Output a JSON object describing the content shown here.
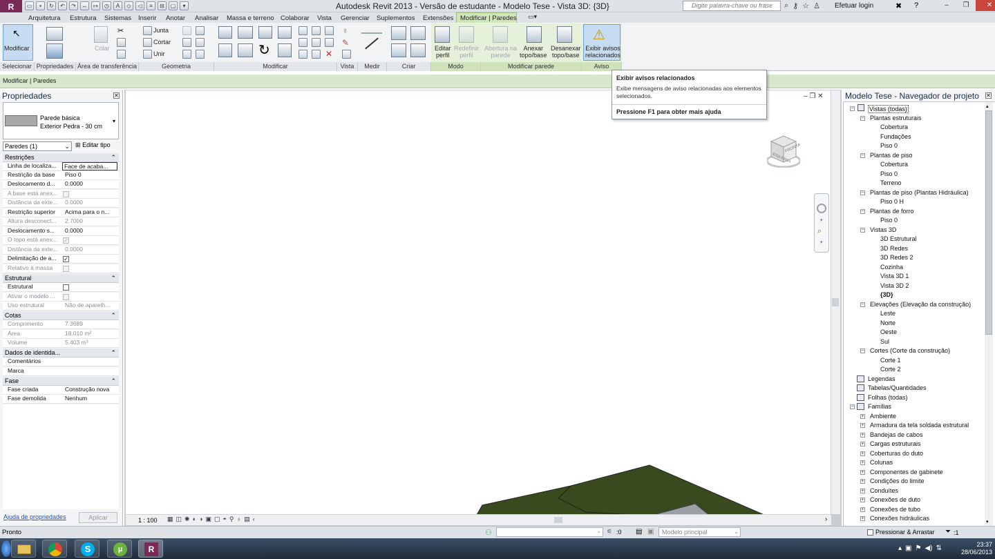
{
  "app": {
    "logo": "R",
    "title": "Autodesk Revit 2013 - Versão de estudante -     Modelo Tese - Vista 3D: {3D}",
    "search_placeholder": "Digite palavra-chave ou frase",
    "login": "Efetuar login"
  },
  "tabs": [
    "Arquitetura",
    "Estrutura",
    "Sistemas",
    "Inserir",
    "Anotar",
    "Analisar",
    "Massa e terreno",
    "Colaborar",
    "Vista",
    "Gerenciar",
    "Suplementos",
    "Extensões",
    "Modificar | Paredes"
  ],
  "ribbon": {
    "modificar": "Modificar",
    "colar": "Colar",
    "junta": "Junta",
    "cortar": "Cortar",
    "unir": "Unir",
    "editar_perfil": [
      "Editar",
      "perfil"
    ],
    "redefinir_perfil": [
      "Redefinir",
      "perfil"
    ],
    "abertura_parede": [
      "Abertura na",
      "parede"
    ],
    "anexar": [
      "Anexar",
      "topo/base"
    ],
    "desanexar": [
      "Desanexar",
      "topo/base"
    ],
    "exibir_avisos": [
      "Exibir avisos",
      "relacionados"
    ],
    "panels": [
      "Selecionar",
      "Propriedades",
      "Área de transferência",
      "Geometria",
      "Modificar",
      "Vista",
      "Medir",
      "Criar",
      "Modo",
      "Modificar parede",
      "Aviso"
    ]
  },
  "options_bar": "Modificar | Paredes",
  "tooltip": {
    "title": "Exibir avisos relacionados",
    "body": "Exibe mensagens de aviso relacionadas aos elementos selecionados.",
    "help": "Pressione F1 para obter mais ajuda"
  },
  "properties": {
    "title": "Propriedades",
    "type_name": "Parede básica",
    "type_sub": "Exterior Pedra - 30 cm",
    "instance": "Paredes (1)",
    "edit_type": "Editar tipo",
    "categories": {
      "restricoes": "Restrições",
      "estrutural": "Estrutural",
      "cotas": "Cotas",
      "dados": "Dados de identida...",
      "fase": "Fase"
    },
    "rows": [
      {
        "name": "Linha de localiza...",
        "value": "Face de acaba..."
      },
      {
        "name": "Restrição da base",
        "value": "Piso 0"
      },
      {
        "name": "Deslocamento d...",
        "value": "0.0000"
      },
      {
        "name": "A base está anex...",
        "value": ""
      },
      {
        "name": "Distância da exte...",
        "value": "0.0000"
      },
      {
        "name": "Restrição superior",
        "value": "Acima para o n..."
      },
      {
        "name": "Altura desconect...",
        "value": "2.7000"
      },
      {
        "name": "Deslocamento s...",
        "value": "0.0000"
      },
      {
        "name": "O topo está anex...",
        "value": ""
      },
      {
        "name": "Distância da exte...",
        "value": "0.0000"
      },
      {
        "name": "Delimitação de a...",
        "value": ""
      },
      {
        "name": "Relativo à massa",
        "value": ""
      },
      {
        "name": "Estrutural",
        "value": ""
      },
      {
        "name": "Ativar o modelo ...",
        "value": ""
      },
      {
        "name": "Uso estrutural",
        "value": "Não de aparelh..."
      },
      {
        "name": "Comprimento",
        "value": "7.3689"
      },
      {
        "name": "Área",
        "value": "18.010 m²"
      },
      {
        "name": "Volume",
        "value": "5.403 m³"
      },
      {
        "name": "Comentários",
        "value": ""
      },
      {
        "name": "Marca",
        "value": ""
      },
      {
        "name": "Fase criada",
        "value": "Construção nova"
      },
      {
        "name": "Fase demolida",
        "value": "Nenhum"
      }
    ],
    "help_link": "Ajuda de propriedades",
    "apply": "Aplicar"
  },
  "viewcube": {
    "left": "ESQUERDA",
    "front": "FRONTAL"
  },
  "view": {
    "scale": "1 : 100"
  },
  "browser": {
    "title": "Modelo Tese - Navegador de projeto",
    "nodes": [
      "Vistas (todas)",
      "Plantas estruturais",
      "Cobertura",
      "Fundações",
      "Piso 0",
      "Plantas de piso",
      "Cobertura",
      "Piso 0",
      "Terreno",
      "Plantas de piso (Plantas Hidráulica)",
      "Piso 0 H",
      "Plantas de forro",
      "Piso 0",
      "Vistas 3D",
      "3D Estrutural",
      "3D Redes",
      "3D Redes 2",
      "Cozinha",
      "Vista 3D 1",
      "Vista 3D 2",
      "{3D}",
      "Elevações (Elevação da construção)",
      "Leste",
      "Norte",
      "Oeste",
      "Sul",
      "Cortes (Corte da construção)",
      "Corte 1",
      "Corte 2",
      "Legendas",
      "Tabelas/Quantidades",
      "Folhas (todas)",
      "Famílias",
      "Ambiente",
      "Armadura da tela soldada estrutural",
      "Bandejas de cabos",
      "Cargas estruturais",
      "Coberturas do duto",
      "Colunas",
      "Componentes de gabinete",
      "Condições do limite",
      "Conduítes",
      "Conexões de duto",
      "Conexões de tubo",
      "Conexões hidráulicas"
    ]
  },
  "status": {
    "text": "Pronto",
    "filter_count": ":0",
    "model": "Modelo principal",
    "press_drag": "Pressionar & Arrastar",
    "sel_count": ":1"
  },
  "clock": {
    "time": "23:37",
    "date": "28/06/2013"
  },
  "colors": {
    "ribbon_context": "#cfe6b8",
    "terrain": "#3a4a1f",
    "taskbar": "#2a3a50"
  }
}
